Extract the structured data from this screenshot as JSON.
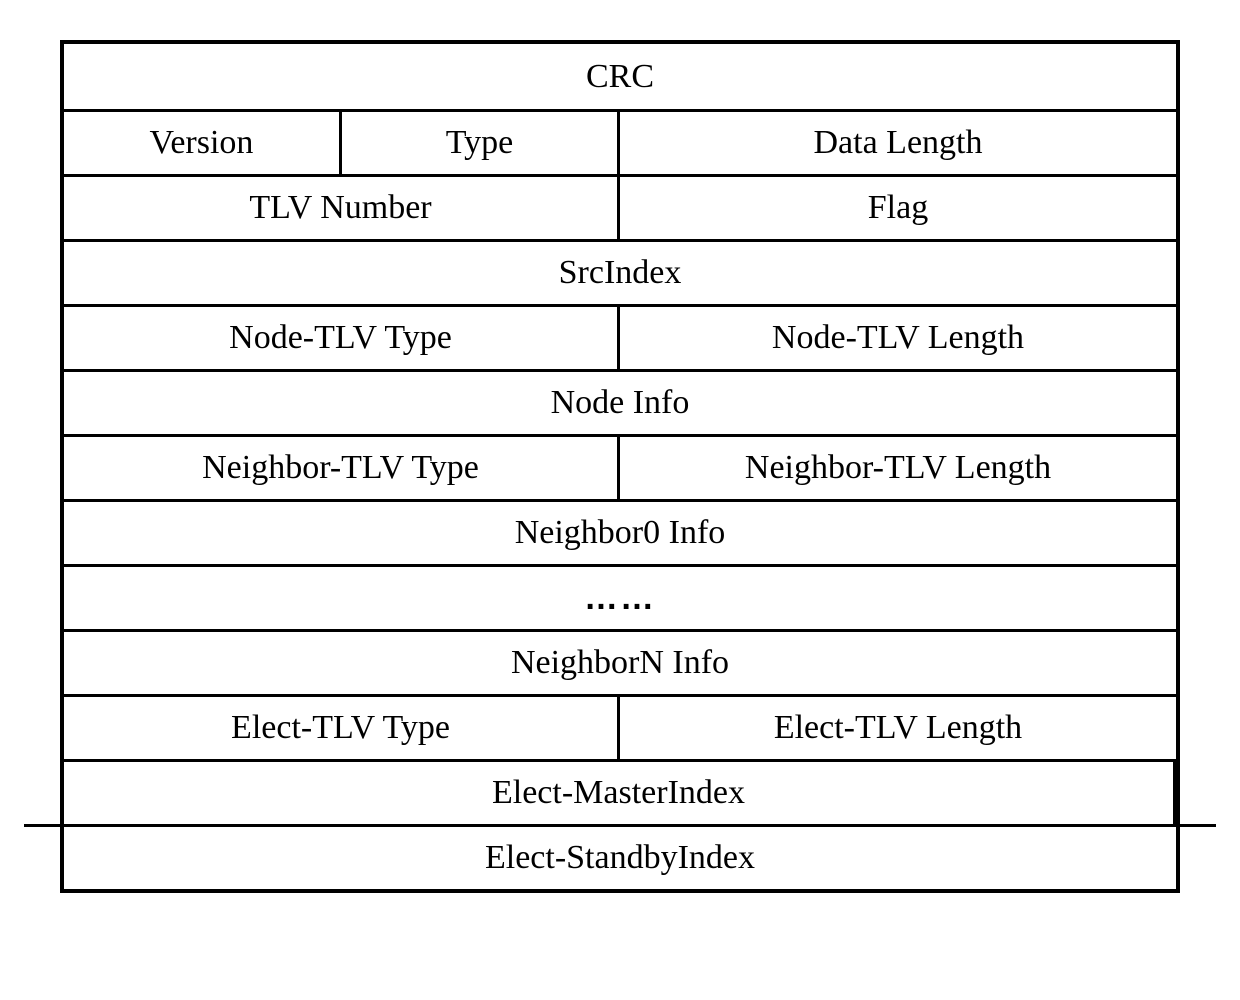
{
  "packet": {
    "rows": [
      {
        "cells": [
          {
            "label": "CRC",
            "class": "full"
          }
        ]
      },
      {
        "cells": [
          {
            "label": "Version",
            "class": "quarter"
          },
          {
            "label": "Type",
            "class": "quarter"
          },
          {
            "label": "Data Length",
            "class": "half"
          }
        ]
      },
      {
        "cells": [
          {
            "label": "TLV Number",
            "class": "half"
          },
          {
            "label": "Flag",
            "class": "half"
          }
        ]
      },
      {
        "cells": [
          {
            "label": "SrcIndex",
            "class": "full"
          }
        ]
      },
      {
        "cells": [
          {
            "label": "Node-TLV Type",
            "class": "half"
          },
          {
            "label": "Node-TLV Length",
            "class": "half"
          }
        ]
      },
      {
        "cells": [
          {
            "label": "Node Info",
            "class": "full"
          }
        ]
      },
      {
        "cells": [
          {
            "label": "Neighbor-TLV Type",
            "class": "half"
          },
          {
            "label": "Neighbor-TLV Length",
            "class": "half"
          }
        ]
      },
      {
        "cells": [
          {
            "label": "Neighbor0  Info",
            "class": "full"
          }
        ]
      },
      {
        "cells": [
          {
            "label": "……",
            "class": "full ellipsis-row"
          }
        ]
      },
      {
        "cells": [
          {
            "label": "NeighborN  Info",
            "class": "full"
          }
        ]
      },
      {
        "cells": [
          {
            "label": "Elect-TLV Type",
            "class": "half"
          },
          {
            "label": "Elect-TLV Length",
            "class": "half"
          }
        ]
      },
      {
        "cells": [
          {
            "label": "Elect-MasterIndex",
            "class": "full"
          }
        ],
        "extendedLine": true
      },
      {
        "cells": [
          {
            "label": "Elect-StandbyIndex",
            "class": "full"
          }
        ]
      }
    ]
  }
}
